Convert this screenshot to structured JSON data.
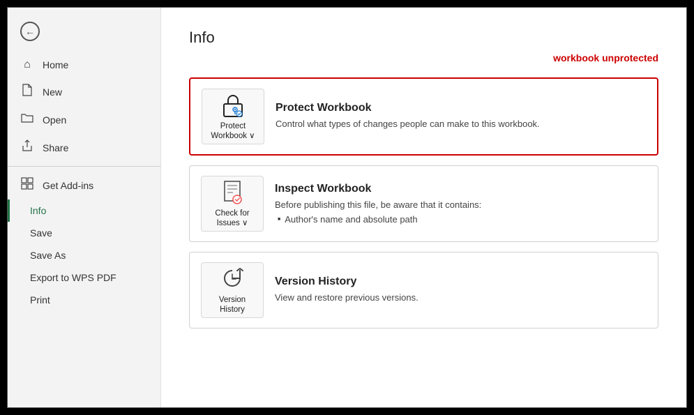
{
  "sidebar": {
    "back_aria": "Back",
    "items": [
      {
        "id": "home",
        "label": "Home",
        "icon": "⌂"
      },
      {
        "id": "new",
        "label": "New",
        "icon": "☐"
      },
      {
        "id": "open",
        "label": "Open",
        "icon": "📂"
      },
      {
        "id": "share",
        "label": "Share",
        "icon": "↗"
      }
    ],
    "divider": true,
    "addon_label": "Get Add-ins",
    "sub_items": [
      {
        "id": "info",
        "label": "Info",
        "active": true
      },
      {
        "id": "save",
        "label": "Save",
        "active": false
      },
      {
        "id": "saveas",
        "label": "Save As",
        "active": false
      },
      {
        "id": "export",
        "label": "Export to WPS PDF",
        "active": false
      },
      {
        "id": "print",
        "label": "Print",
        "active": false
      }
    ]
  },
  "main": {
    "page_title": "Info",
    "workbook_status": "workbook unprotected",
    "cards": [
      {
        "id": "protect",
        "icon_label": "Protect\nWorkbook ∨",
        "title": "Protect Workbook",
        "description": "Control what types of changes people can make to this workbook.",
        "highlighted": true,
        "list_items": []
      },
      {
        "id": "inspect",
        "icon_label": "Check for\nIssues ∨",
        "title": "Inspect Workbook",
        "description": "Before publishing this file, be aware that it contains:",
        "highlighted": false,
        "list_items": [
          "Author's name and absolute path"
        ]
      },
      {
        "id": "history",
        "icon_label": "Version\nHistory",
        "title": "Version History",
        "description": "View and restore previous versions.",
        "highlighted": false,
        "list_items": []
      }
    ]
  }
}
